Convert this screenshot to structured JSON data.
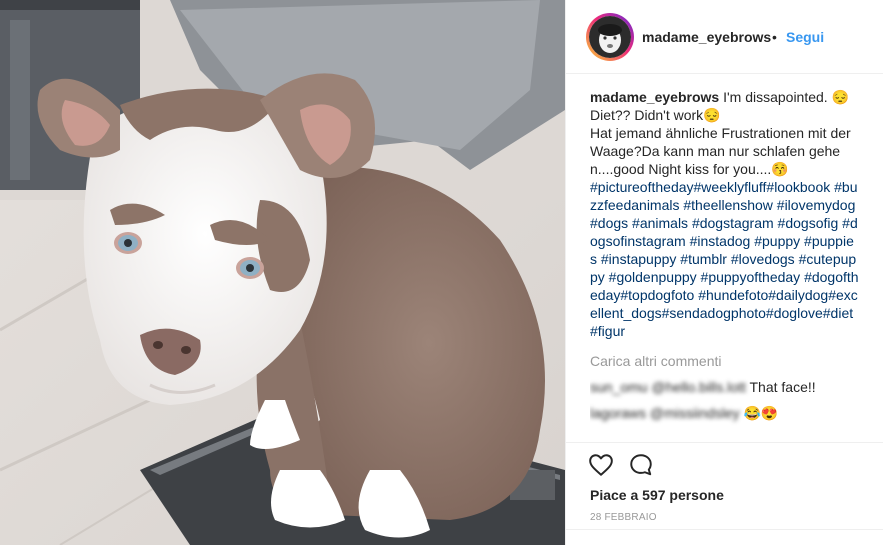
{
  "post": {
    "username": "madame_eyebrows",
    "follow_label": "Segui",
    "separator": "•",
    "caption_text": " I'm dissapointed. 😔 Diet?? Didn't work😔\nHat jemand ähnliche Frustrationen mit der Waage?Da kann man nur schlafen gehen....good Night kiss for you....😚\n",
    "hashtags": "#pictureoftheday#weeklyfluff#lookbook #buzzfeedanimals #theellenshow #ilovemydog #dogs #animals #dogstagram #dogsofig #dogsofinstagram #instadog #puppy #puppies #instapuppy #tumblr #lovedogs #cutepuppy #goldenpuppy #puppyoftheday #dogoftheday#topdogfoto #hundefoto#dailydog#excellent_dogs#sendadogphoto#doglove#diet#figur",
    "load_more_label": "Carica altri commenti",
    "comments": [
      {
        "user": "sun_omu",
        "mention": "@hello.bills.lott",
        "text": "That face!!"
      },
      {
        "user": "lagoraws",
        "mention": "@missiindsley",
        "text": "😂😍"
      }
    ],
    "likes_label": "Piace a 597 persone",
    "date_label": "28 FEBBRAIO"
  },
  "icons": {
    "like": "heart-icon",
    "comment": "comment-bubble-icon"
  },
  "colors": {
    "link_blue": "#3897f0",
    "hashtag": "#003569",
    "muted": "#999999",
    "border": "#efefef"
  }
}
